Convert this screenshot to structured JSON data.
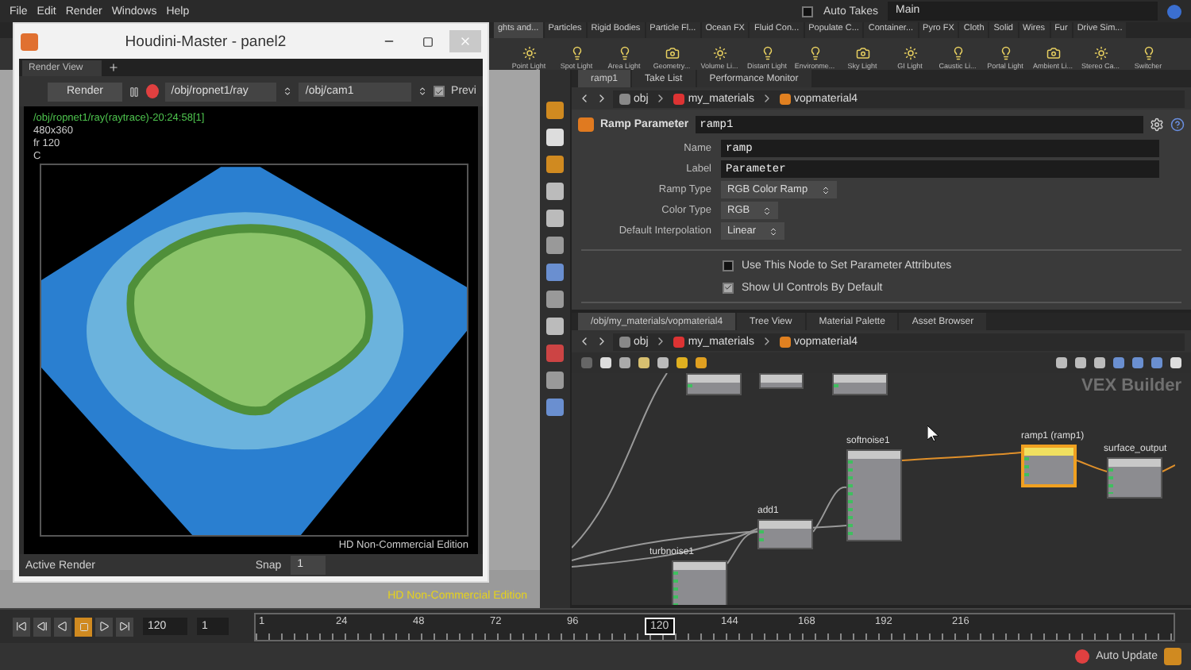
{
  "menu_bar": {
    "items": [
      "File",
      "Edit",
      "Render",
      "Windows",
      "Help"
    ],
    "auto_takes": {
      "label": "Auto Takes",
      "checked": false
    },
    "desktop": "Main"
  },
  "shelf": {
    "tabs": [
      {
        "label": "ghts and...",
        "selected": true
      },
      {
        "label": "Particles",
        "selected": false
      },
      {
        "label": "Rigid Bodies",
        "selected": false
      },
      {
        "label": "Particle Fl...",
        "selected": false
      },
      {
        "label": "Ocean FX",
        "selected": false
      },
      {
        "label": "Fluid Con...",
        "selected": false
      },
      {
        "label": "Populate C...",
        "selected": false
      },
      {
        "label": "Container...",
        "selected": false
      },
      {
        "label": "Pyro FX",
        "selected": false
      },
      {
        "label": "Cloth",
        "selected": false
      },
      {
        "label": "Solid",
        "selected": false
      },
      {
        "label": "Wires",
        "selected": false
      },
      {
        "label": "Fur",
        "selected": false
      },
      {
        "label": "Drive Sim...",
        "selected": false
      }
    ],
    "tools": [
      "Point Light",
      "Spot Light",
      "Area Light",
      "Geometry...",
      "Volume Li...",
      "Distant Light",
      "Environme...",
      "Sky Light",
      "GI Light",
      "Caustic Li...",
      "Portal Light",
      "Ambient Li...",
      "Stereo Ca...",
      "Switcher"
    ]
  },
  "parameter_pane": {
    "tabs": [
      {
        "label": "ramp1",
        "selected": true
      },
      {
        "label": "Take List",
        "selected": false
      },
      {
        "label": "Performance Monitor",
        "selected": false
      }
    ],
    "path": [
      "obj",
      "my_materials",
      "vopmaterial4"
    ],
    "node_type": "Ramp Parameter",
    "node_name": "ramp1",
    "fields": [
      {
        "label": "Name",
        "value": "ramp",
        "kind": "text"
      },
      {
        "label": "Label",
        "value": "Parameter",
        "kind": "text"
      },
      {
        "label": "Ramp Type",
        "value": "RGB Color Ramp",
        "kind": "menu"
      },
      {
        "label": "Color Type",
        "value": "RGB",
        "kind": "menu"
      },
      {
        "label": "Default Interpolation",
        "value": "Linear",
        "kind": "menu"
      }
    ],
    "toggles": [
      {
        "label": "Use This Node to Set Parameter Attributes",
        "checked": false
      },
      {
        "label": "Show UI Controls By Default",
        "checked": true
      }
    ]
  },
  "network_pane": {
    "tabs": [
      {
        "label": "/obj/my_materials/vopmaterial4",
        "selected": true
      },
      {
        "label": "Tree View",
        "selected": false
      },
      {
        "label": "Material Palette",
        "selected": false
      },
      {
        "label": "Asset Browser",
        "selected": false
      }
    ],
    "path": [
      "obj",
      "my_materials",
      "vopmaterial4"
    ],
    "context": "VEX Builder",
    "nodes": [
      {
        "name": "softnoise1",
        "selected": false
      },
      {
        "name": "ramp1 (ramp1)",
        "selected": true
      },
      {
        "name": "surface_output",
        "selected": false
      },
      {
        "name": "add1",
        "selected": false
      },
      {
        "name": "turbnoise1",
        "selected": false
      }
    ]
  },
  "render_window": {
    "title": "Houdini-Master - panel2",
    "tab": "Render View",
    "render_button": "Render",
    "rop_path": "/obj/ropnet1/ray",
    "camera": "/obj/cam1",
    "preview": {
      "label": "Previ",
      "checked": true
    },
    "info": [
      "/obj/ropnet1/ray(raytrace)-20:24:58[1]",
      "480x360",
      "fr 120",
      "C"
    ],
    "edition": "HD Non-Commercial Edition",
    "status": "Active Render",
    "snap": {
      "label": "Snap",
      "value": "1"
    }
  },
  "viewport": {
    "edition": "HD Non-Commercial Edition"
  },
  "timeline": {
    "frame": "120",
    "step": "1",
    "ticks": [
      {
        "label": "1",
        "selected": false
      },
      {
        "label": "24",
        "selected": false
      },
      {
        "label": "48",
        "selected": false
      },
      {
        "label": "72",
        "selected": false
      },
      {
        "label": "96",
        "selected": false
      },
      {
        "label": "120",
        "selected": true
      },
      {
        "label": "144",
        "selected": false
      },
      {
        "label": "168",
        "selected": false
      },
      {
        "label": "192",
        "selected": false
      },
      {
        "label": "216",
        "selected": false
      }
    ]
  },
  "status_bar": {
    "auto_update": "Auto Update"
  }
}
